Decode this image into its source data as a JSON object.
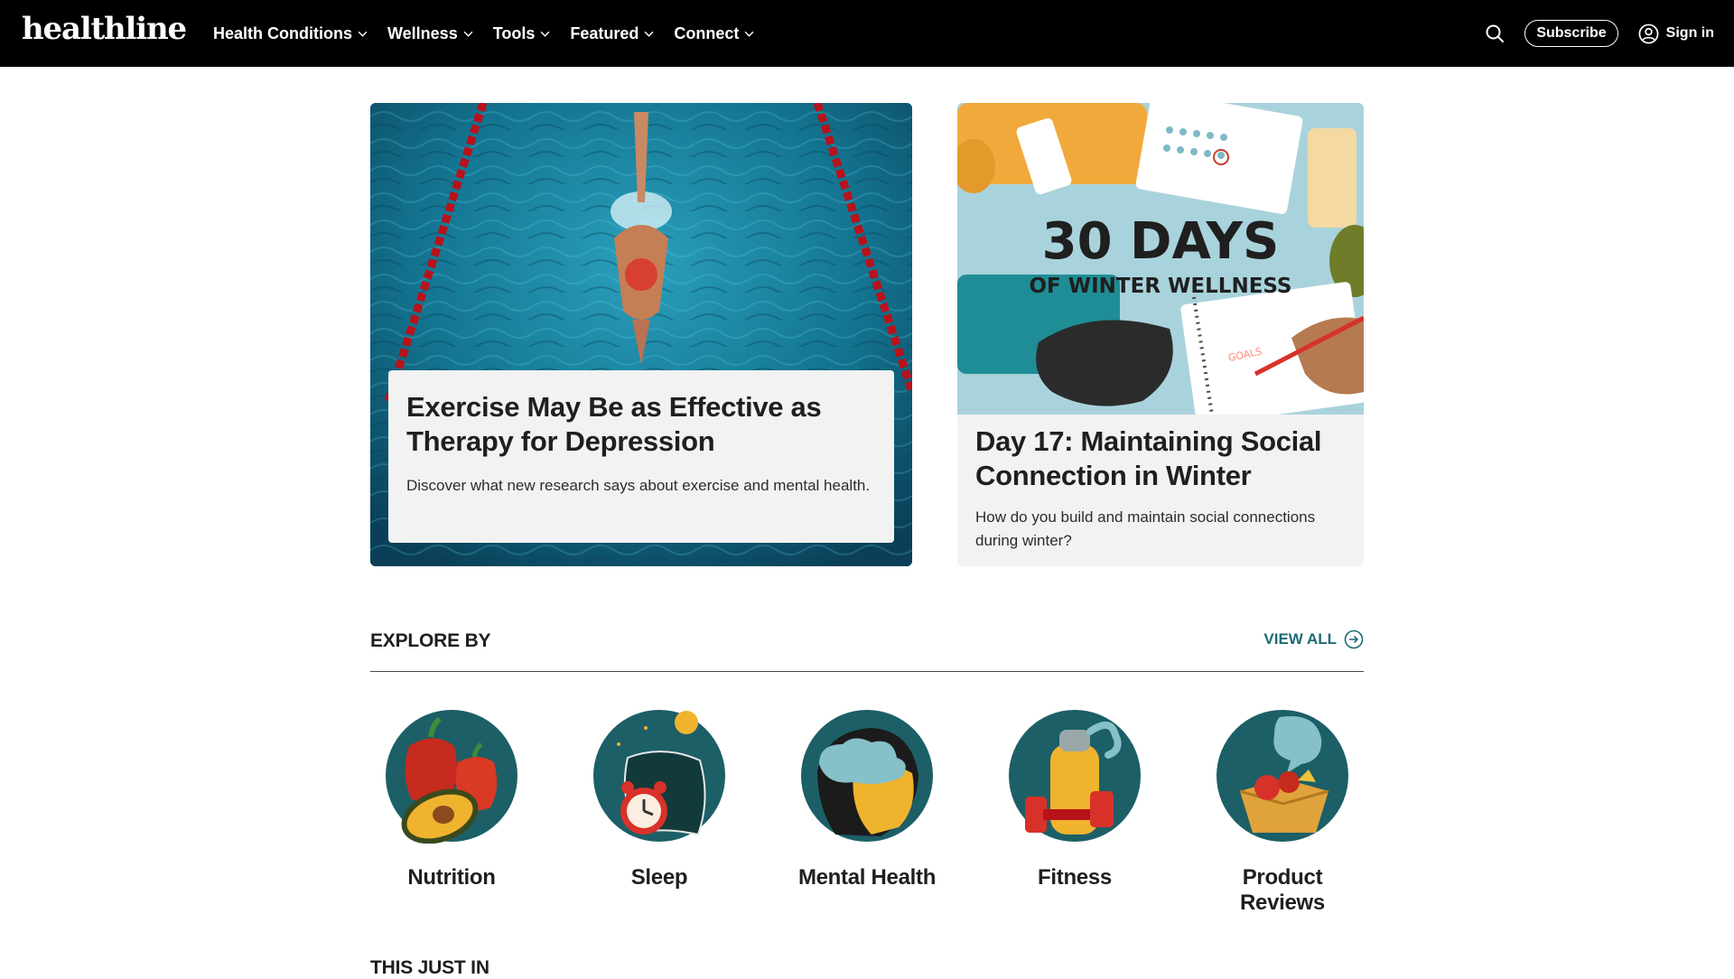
{
  "header": {
    "logo": "healthline",
    "nav": [
      {
        "label": "Health Conditions"
      },
      {
        "label": "Wellness"
      },
      {
        "label": "Tools"
      },
      {
        "label": "Featured"
      },
      {
        "label": "Connect"
      }
    ],
    "subscribe_label": "Subscribe",
    "signin_label": "Sign in"
  },
  "hero": {
    "left": {
      "title": "Exercise May Be as Effective as Therapy for Depression",
      "dek": "Discover what new research says about exercise and mental health."
    },
    "right": {
      "image_text_line1": "30 DAYS",
      "image_text_line2": "OF WINTER WELLNESS",
      "image_note": "GOALS",
      "title": "Day 17: Maintaining Social Connection in Winter",
      "dek": "How do you build and maintain social connections during winter?"
    }
  },
  "explore": {
    "title": "EXPLORE BY",
    "view_all": "VIEW ALL",
    "topics": [
      {
        "label": "Nutrition",
        "icon": "nutrition-icon"
      },
      {
        "label": "Sleep",
        "icon": "sleep-icon"
      },
      {
        "label": "Mental Health",
        "icon": "mental-health-icon"
      },
      {
        "label": "Fitness",
        "icon": "fitness-icon"
      },
      {
        "label": "Product Reviews",
        "icon": "product-reviews-icon"
      }
    ]
  },
  "just_in": {
    "title": "THIS JUST IN"
  },
  "colors": {
    "header_bg": "#000000",
    "accent_teal": "#1b6a73",
    "card_bg": "#f2f2f2",
    "icon_circle": "#1c5f66"
  }
}
